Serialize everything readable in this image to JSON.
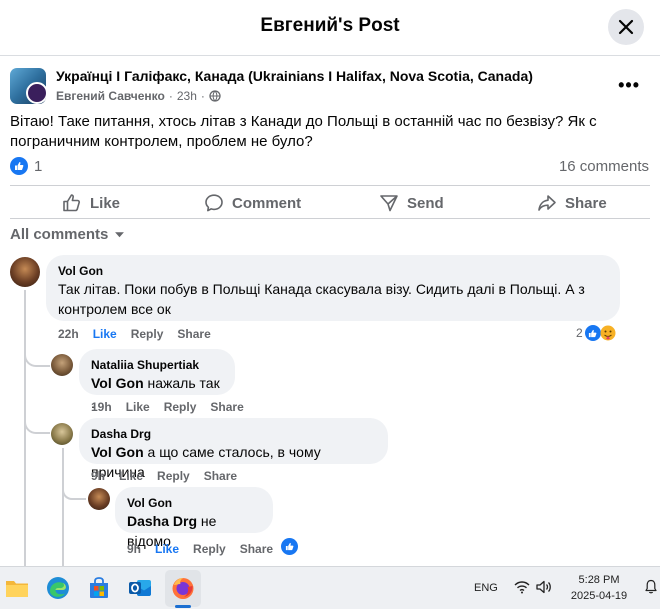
{
  "header": {
    "title": "Евгений's Post"
  },
  "post": {
    "group": "Українці І Галіфакс, Канада (Ukrainians I Halifax, Nova Scotia, Canada)",
    "author": "Евгений Савченко",
    "time": "23h",
    "text": "Вітаю! Таке питання, хтось літав з Канади до Польщі в останній час по безвізу? Як с пограничним контролем, проблем не було?",
    "reaction_count": "1",
    "comments_count": "16 comments"
  },
  "actions": {
    "like": "Like",
    "comment": "Comment",
    "send": "Send",
    "share": "Share"
  },
  "comments_filter": "All comments",
  "comments": [
    {
      "name": "Vol Gon",
      "mention": "",
      "text": "Так літав. Поки побув в Польщі Канада скасувала візу. Сидить далі в Польщі. А з контролем все ок",
      "time": "22h",
      "like": "Like",
      "reply": "Reply",
      "share": "Share",
      "reaction_count": "2",
      "liked": true
    },
    {
      "name": "Nataliia Shupertiak",
      "mention": "Vol Gon",
      "text": " нажаль так .",
      "time": "19h",
      "like": "Like",
      "reply": "Reply",
      "share": "Share"
    },
    {
      "name": "Dasha Drg",
      "mention": "Vol Gon",
      "text": " а що саме сталось, в чому причина",
      "time": "9h",
      "like": "Like",
      "reply": "Reply",
      "share": "Share"
    },
    {
      "name": "Vol Gon",
      "mention": "Dasha Drg",
      "text": " не відомо",
      "time": "9h",
      "like": "Like",
      "reply": "Reply",
      "share": "Share",
      "liked": true
    }
  ],
  "taskbar": {
    "lang": "ENG",
    "time": "5:28 PM",
    "date": "2025-04-19",
    "apps": [
      "file-explorer",
      "edge",
      "microsoft-store",
      "outlook",
      "firefox"
    ]
  },
  "colors": {
    "accent": "#1877f2",
    "text": "#050505",
    "secondary": "#65676b",
    "bubble": "#f0f2f5"
  }
}
